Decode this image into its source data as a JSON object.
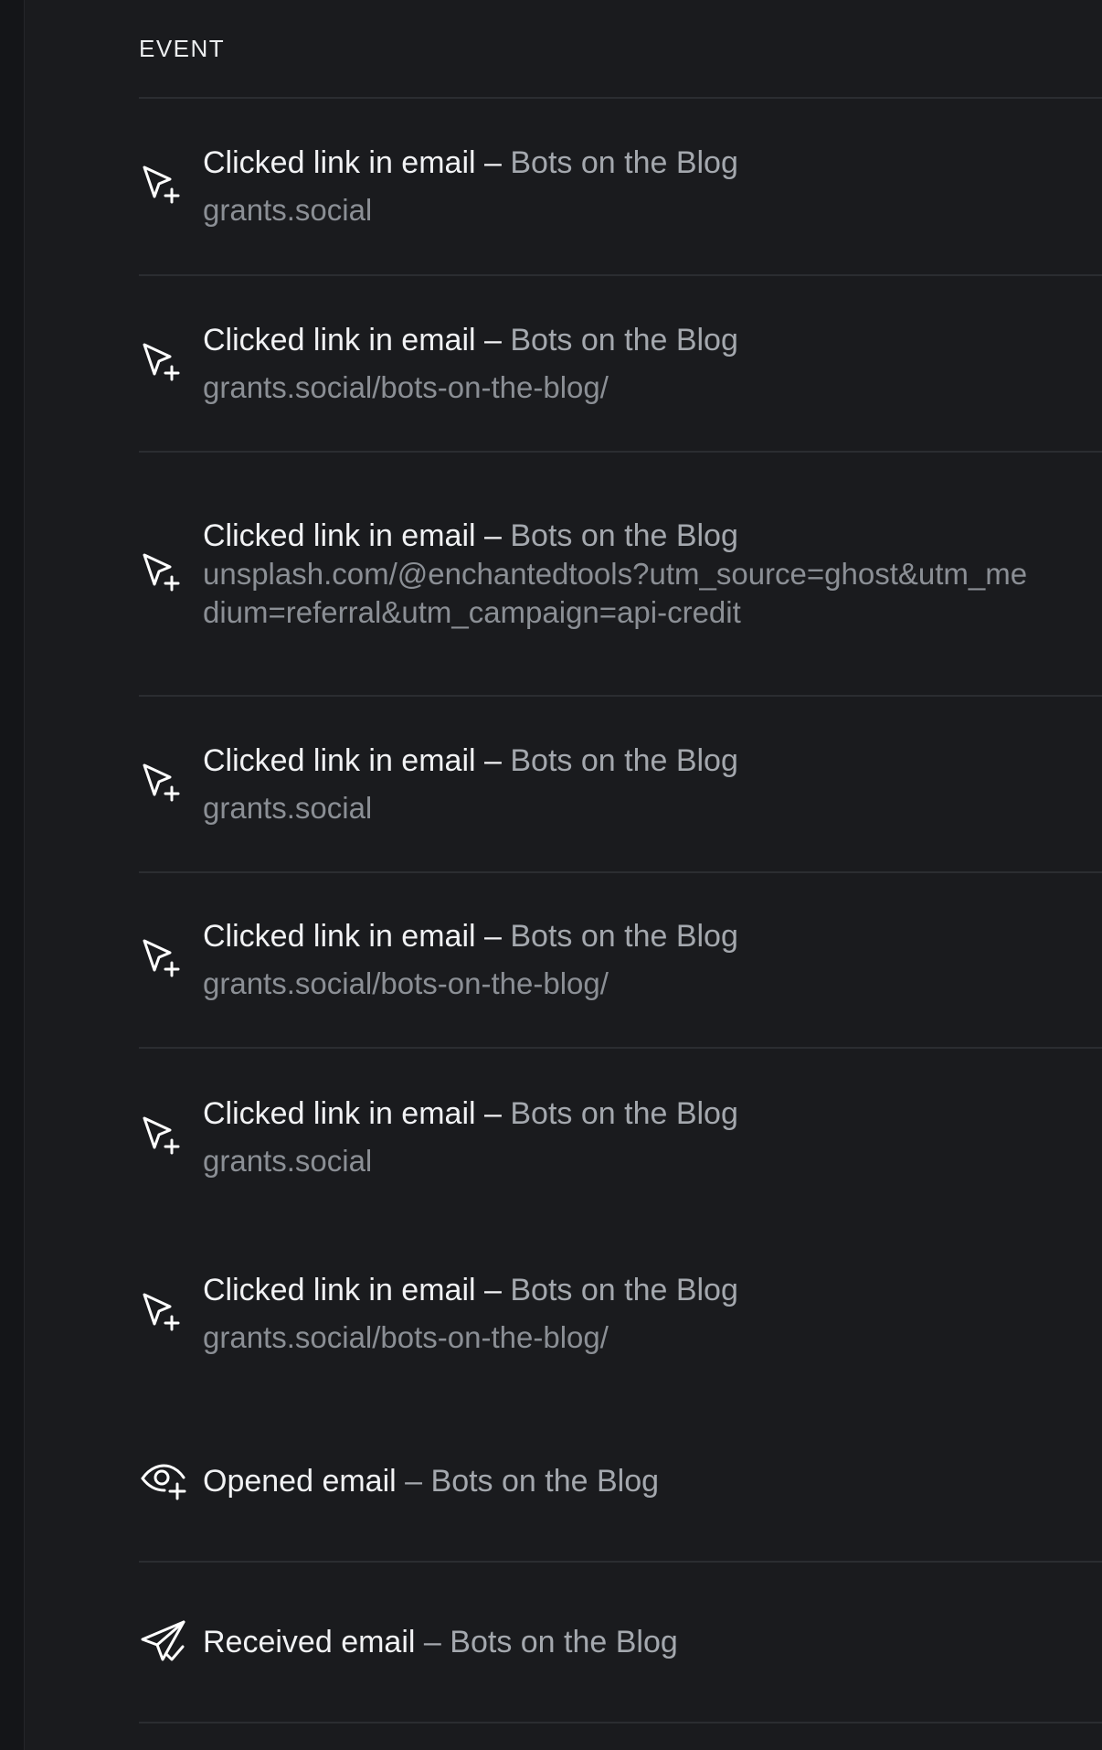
{
  "table": {
    "column_header": "EVENT"
  },
  "events": [
    {
      "action": "Clicked link in email",
      "dash": "–",
      "newsletter": "Bots on the Blog",
      "url": "grants.social",
      "icon": "cursor-click-icon"
    },
    {
      "action": "Clicked link in email",
      "dash": "–",
      "newsletter": "Bots on the Blog",
      "url": "grants.social/bots-on-the-blog/",
      "icon": "cursor-click-icon"
    },
    {
      "action": "Clicked link in email",
      "dash": "–",
      "newsletter": "Bots on the Blog",
      "url": "unsplash.com/@enchantedtools?utm_source=ghost&utm_medium=referral&utm_campaign=api-credit",
      "icon": "cursor-click-icon"
    },
    {
      "action": "Clicked link in email",
      "dash": "–",
      "newsletter": "Bots on the Blog",
      "url": "grants.social",
      "icon": "cursor-click-icon"
    },
    {
      "action": "Clicked link in email",
      "dash": "–",
      "newsletter": "Bots on the Blog",
      "url": "grants.social/bots-on-the-blog/",
      "icon": "cursor-click-icon"
    },
    {
      "action": "Clicked link in email",
      "dash": "–",
      "newsletter": "Bots on the Blog",
      "url": "grants.social",
      "icon": "cursor-click-icon"
    },
    {
      "action": "Clicked link in email",
      "dash": "–",
      "newsletter": "Bots on the Blog",
      "url": "grants.social/bots-on-the-blog/",
      "icon": "cursor-click-icon"
    },
    {
      "action": "Opened email",
      "dash": "–",
      "newsletter": "Bots on the Blog",
      "icon": "eye-plus-icon"
    },
    {
      "action": "Received email",
      "dash": "–",
      "newsletter": "Bots on the Blog",
      "icon": "send-check-icon"
    }
  ],
  "colors": {
    "background": "#1a1b1e",
    "text_primary": "#f1f2f4",
    "text_secondary": "#a4a8ae",
    "text_url": "#8b8f95",
    "divider": "#2b2d31"
  }
}
